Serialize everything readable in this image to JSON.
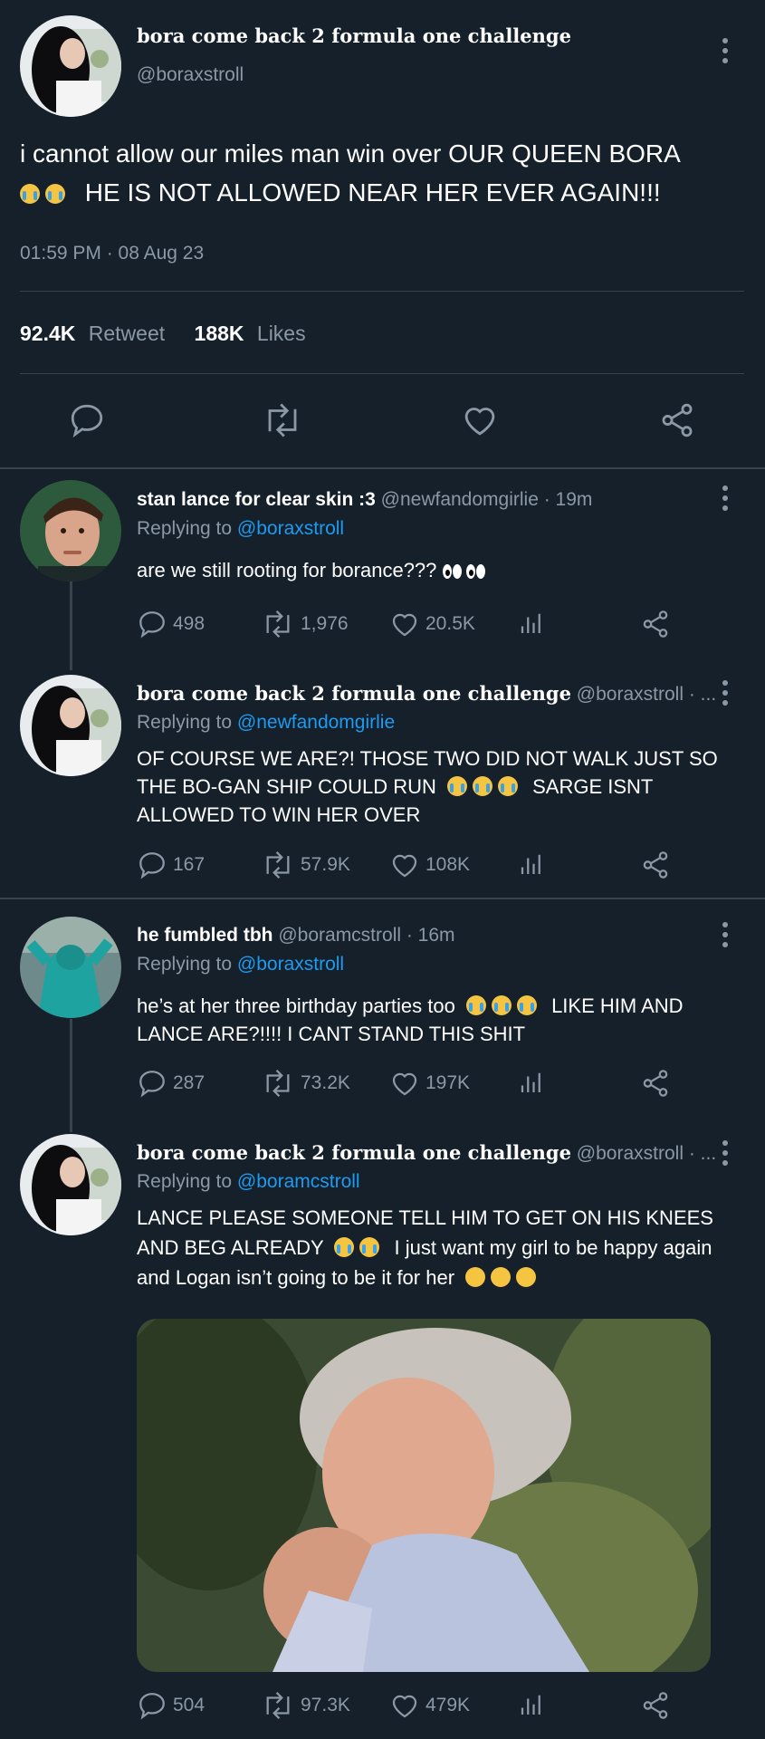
{
  "main_tweet": {
    "display_name": "bora come back 2 formula one challenge",
    "handle": "@boraxstroll",
    "text_line1": "i cannot allow our miles man win over OUR QUEEN BORA",
    "text_line2": "HE IS NOT ALLOWED NEAR HER EVER AGAIN!!!",
    "timestamp": "01:59 PM · 08 Aug 23",
    "retweet_count": "92.4K",
    "retweet_label": "Retweet",
    "likes_count": "188K",
    "likes_label": "Likes"
  },
  "replies": [
    {
      "display_name": "stan lance for clear skin :3",
      "handle_time": "@newfandomgirlie · 19m",
      "replying_prefix": "Replying to",
      "replying_to": "@boraxstroll",
      "text": "are we still rooting for borance???",
      "replies": "498",
      "retweets": "1,976",
      "likes": "20.5K"
    },
    {
      "display_name": "bora come back 2 formula one challenge",
      "handle_time": "@boraxstroll · ...",
      "replying_prefix": "Replying to",
      "replying_to": "@newfandomgirlie",
      "text_line1": "OF COURSE WE ARE?! THOSE TWO DID NOT WALK JUST SO",
      "text_line2a": "THE BO-GAN SHIP COULD RUN",
      "text_line2b": "SARGE ISNT",
      "text_line3": "ALLOWED TO WIN HER OVER",
      "replies": "167",
      "retweets": "57.9K",
      "likes": "108K"
    },
    {
      "display_name": "he fumbled tbh",
      "handle_time": "@boramcstroll · 16m",
      "replying_prefix": "Replying to",
      "replying_to": "@boraxstroll",
      "text_line1a": "he’s at her three birthday parties too",
      "text_line1b": "LIKE HIM AND",
      "text_line2": "LANCE ARE?!!!! I CANT STAND THIS SHIT",
      "replies": "287",
      "retweets": "73.2K",
      "likes": "197K"
    },
    {
      "display_name": "bora come back 2 formula one challenge",
      "handle_time": "@boraxstroll · ...",
      "replying_prefix": "Replying to",
      "replying_to": "@boramcstroll",
      "text_line1": "LANCE PLEASE SOMEONE TELL HIM TO GET ON HIS KNEES",
      "text_line2a": "AND BEG ALREADY",
      "text_line2b": "I just want my girl to be happy again",
      "text_line3": "and Logan isn’t going to be it for her",
      "replies": "504",
      "retweets": "97.3K",
      "likes": "479K"
    }
  ],
  "colors": {
    "background": "#15202b",
    "muted": "#8b98a5",
    "link": "#1d9bf0",
    "divider": "#38444d"
  }
}
